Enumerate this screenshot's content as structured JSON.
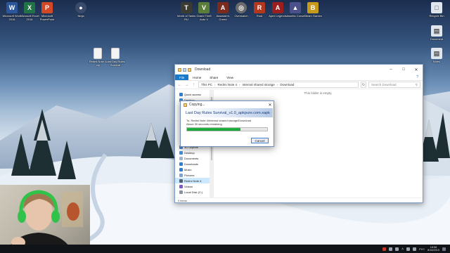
{
  "desktop": {
    "icons_left": [
      {
        "label": "Microsoft Word 2016",
        "glyph": "W",
        "color": "#2b579a"
      },
      {
        "label": "Microsoft Excel 2016",
        "glyph": "X",
        "color": "#217346"
      },
      {
        "label": "Microsoft PowerPoint",
        "glyph": "P",
        "color": "#d24726"
      },
      {
        "label": "Ninja",
        "glyph": "●",
        "color": "#3a4a6b"
      }
    ],
    "icons_top": [
      {
        "label": "World of Tanks RU",
        "glyph": "T",
        "color": "#3b3b33"
      },
      {
        "label": "Grand Theft Auto V",
        "glyph": "V",
        "color": "#5b7d3a"
      },
      {
        "label": "Assassin's Creed",
        "glyph": "A",
        "color": "#7a2b1d"
      },
      {
        "label": "Overwatch",
        "glyph": "◎",
        "color": "#6b6b6b"
      },
      {
        "label": "Rust",
        "glyph": "R",
        "color": "#b3371c"
      },
      {
        "label": "Apex Legends",
        "glyph": "A",
        "color": "#9c1d1d"
      },
      {
        "label": "Assetto Corsa",
        "glyph": "▲",
        "color": "#4b4f8a"
      },
      {
        "label": "Steam Games",
        "glyph": "B",
        "color": "#c79a1c"
      }
    ],
    "icons_mid": [
      {
        "label": "Redmi Note 4 .zip",
        "glyph": "",
        "color": "#f4f4f4"
      },
      {
        "label": "Last Day Rules Survival",
        "glyph": "",
        "color": "#f4f4f4"
      }
    ],
    "icons_right": [
      {
        "label": "Recycle Bin",
        "glyph": "□",
        "color": "#dfe6ee"
      },
      {
        "label": "Document",
        "glyph": "▤",
        "color": "#dfe6ee"
      },
      {
        "label": "Notes",
        "glyph": "▤",
        "color": "#dfe6ee"
      }
    ]
  },
  "explorer": {
    "title": "Download",
    "ribbon_tabs": [
      "File",
      "Home",
      "Share",
      "View"
    ],
    "address": [
      "This PC",
      "Redmi Note 4",
      "Internal shared storage",
      "Download"
    ],
    "search_placeholder": "Search Download",
    "empty_text": "This folder is empty.",
    "nav_top": [
      {
        "label": "Quick access",
        "color": "#2d7fd6"
      },
      {
        "label": "Desktop",
        "color": "#3f8fdf"
      }
    ],
    "nav_bottom": [
      {
        "label": "3D Objects",
        "color": "#4b88d0"
      },
      {
        "label": "Desktop",
        "color": "#3f8fdf"
      },
      {
        "label": "Documents",
        "color": "#9fb6cf"
      },
      {
        "label": "Downloads",
        "color": "#2d7fd6"
      },
      {
        "label": "Music",
        "color": "#2d7fd6"
      },
      {
        "label": "Pictures",
        "color": "#7aa4d6"
      },
      {
        "label": "Redmi Note 4",
        "color": "#555f6b",
        "selected": true
      },
      {
        "label": "Videos",
        "color": "#7a5ac4"
      },
      {
        "label": "Local Disk (C:)",
        "color": "#8a929c"
      }
    ],
    "status": "0 items"
  },
  "dialog": {
    "title": "Copying...",
    "header": "Last Day Rules Survival_v1.0_apkpure.com.xapk",
    "to_line": "To: Redmi Note 4\\Internal shared storage\\Download",
    "time_line": "About 30 seconds remaining",
    "progress_percent": 67,
    "cancel_label": "Cancel"
  },
  "taskbar": {
    "lang": "РУС",
    "time": "18:58",
    "date": "8/18/2019"
  },
  "colors": {
    "accent": "#1979ca",
    "progress": "#0e9f2e",
    "taskbar": "#101418"
  }
}
